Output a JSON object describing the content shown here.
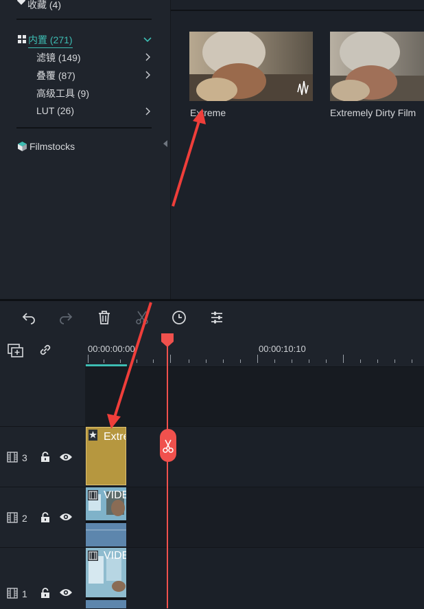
{
  "sidebar": {
    "favorites": "收藏 (4)",
    "builtin": "内置 (271)",
    "items": [
      {
        "label": "滤镜 (149)",
        "has_chevron": true
      },
      {
        "label": "叠覆 (87)",
        "has_chevron": true
      },
      {
        "label": "高级工具 (9)",
        "has_chevron": false
      },
      {
        "label": "LUT (26)",
        "has_chevron": true
      }
    ],
    "filmstocks": "Filmstocks"
  },
  "media": {
    "thumbnails": [
      {
        "label": "Extreme"
      },
      {
        "label": "Extremely Dirty Film"
      }
    ]
  },
  "toolbar": {
    "icons": [
      "undo-icon",
      "redo-icon",
      "delete-icon",
      "cut-icon",
      "speed-icon",
      "adjust-icon"
    ]
  },
  "timeline": {
    "ruler": {
      "start": "00:00:00:00",
      "mark": "00:00:10:10"
    },
    "tracks": [
      {
        "number": "3",
        "clip": "Extreme",
        "clip_type": "effect"
      },
      {
        "number": "2",
        "clip": "VIDEO",
        "clip_type": "video"
      },
      {
        "number": "1",
        "clip": "VIDEO",
        "clip_type": "video"
      }
    ]
  },
  "colors": {
    "accent": "#3dbdb3",
    "playhead": "#f0514d",
    "effect_clip": "#b6973f",
    "video_clip": "#4a7fa6",
    "annotation_arrow": "#ef3e3a"
  }
}
